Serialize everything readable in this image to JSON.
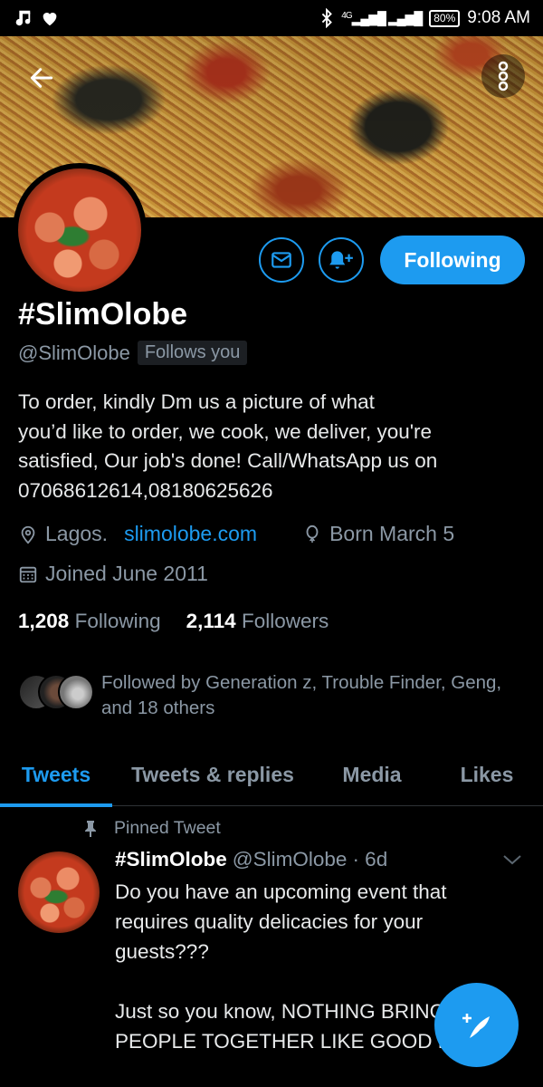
{
  "status_bar": {
    "network": "4G",
    "battery": "80%",
    "time": "9:08 AM"
  },
  "profile": {
    "display_name": "#SlimOlobe",
    "handle": "@SlimOlobe",
    "follows_you": "Follows you",
    "bio_lines": [
      "To order, kindly Dm us a picture of what",
      "you’d like to order, we cook, we deliver, you're",
      "satisfied, Our job's done! Call/WhatsApp us on",
      "07068612614,08180625626"
    ],
    "location": "Lagos.",
    "website": "slimolobe.com",
    "birthday": "Born March 5",
    "joined": "Joined June 2011",
    "following_count": "1,208",
    "following_label": "Following",
    "followers_count": "2,114",
    "followers_label": "Followers",
    "followed_by_line1": "Followed by Generation z, Trouble Finder, Geng,",
    "followed_by_line2": "and 18 others"
  },
  "actions": {
    "following_button": "Following"
  },
  "tabs": [
    {
      "label": "Tweets",
      "active": true
    },
    {
      "label": "Tweets & replies",
      "active": false
    },
    {
      "label": "Media",
      "active": false
    },
    {
      "label": "Likes",
      "active": false
    }
  ],
  "pinned_tweet": {
    "pinned_label": "Pinned Tweet",
    "author_name": "#SlimOlobe",
    "author_handle": "@SlimOlobe",
    "time": "· 6d",
    "body_lines": [
      "Do you have an upcoming event that",
      "requires quality delicacies for your",
      "guests???",
      "",
      "Just so you know, NOTHING BRINGS",
      "PEOPLE TOGETHER LIKE GOOD FOOD"
    ]
  },
  "colors": {
    "accent": "#1d9bf0",
    "background": "#000000",
    "muted_text": "#8b98a5"
  },
  "icons": [
    "music-note-icon",
    "heart-icon",
    "bluetooth-icon",
    "signal-icon",
    "back-arrow-icon",
    "more-vertical-icon",
    "mail-icon",
    "bell-plus-icon",
    "location-pin-icon",
    "balloon-icon",
    "calendar-icon",
    "pin-icon",
    "chevron-down-icon",
    "compose-feather-icon"
  ]
}
